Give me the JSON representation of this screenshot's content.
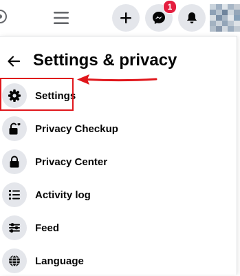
{
  "topbar": {
    "icons": [
      "edge-circle-icon",
      "hamburger-menu-icon",
      "plus-icon",
      "messenger-icon",
      "bell-icon"
    ],
    "messenger_badge": "1",
    "avatar": "blurred-profile-picture"
  },
  "panel": {
    "title": "Settings & privacy",
    "back_icon": "left-arrow-icon",
    "items": [
      {
        "label": "Settings",
        "icon": "gear-icon"
      },
      {
        "label": "Privacy Checkup",
        "icon": "lock-heart-icon"
      },
      {
        "label": "Privacy Center",
        "icon": "lock-icon"
      },
      {
        "label": "Activity log",
        "icon": "list-icon"
      },
      {
        "label": "Feed",
        "icon": "sliders-icon"
      },
      {
        "label": "Language",
        "icon": "globe-icon"
      }
    ]
  },
  "annotation": {
    "highlight_color": "#e0161b",
    "arrow_color": "#e0161b",
    "target": "Settings"
  },
  "colors": {
    "icon_bg": "#e4e6eb",
    "badge": "#e41e3f",
    "text": "#050505"
  }
}
